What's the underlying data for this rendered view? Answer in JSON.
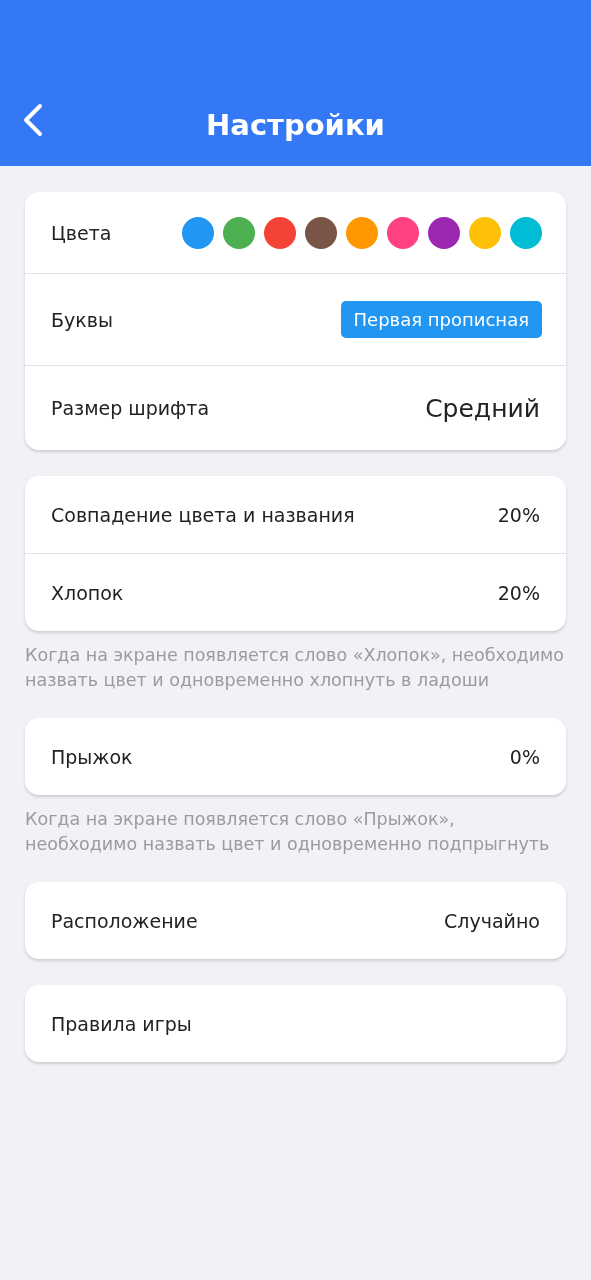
{
  "header": {
    "title": "Настройки"
  },
  "sections": [
    {
      "rows": [
        {
          "kind": "colors",
          "label": "Цвета",
          "colors": [
            {
              "color": "#2196f3"
            },
            {
              "color": "#4caf50"
            },
            {
              "color": "#f44336"
            },
            {
              "color": "#795548"
            },
            {
              "color": "#ff9800"
            },
            {
              "color": "#ff4081"
            },
            {
              "color": "#9c27b0"
            },
            {
              "color": "#ffc107"
            },
            {
              "color": "#00bcd4"
            }
          ]
        },
        {
          "kind": "chip",
          "label": "Буквы",
          "value": "Первая прописная"
        },
        {
          "kind": "large",
          "label": "Размер шрифта",
          "value": "Средний"
        }
      ]
    },
    {
      "rows": [
        {
          "kind": "value",
          "label": "Совпадение цвета и названия",
          "value": "20%"
        },
        {
          "kind": "value",
          "label": "Хлопок",
          "value": "20%"
        }
      ],
      "note": "Когда на экране появляется слово «Хлопок», необходимо назвать цвет и одновременно хлопнуть в ладоши"
    },
    {
      "rows": [
        {
          "kind": "value",
          "label": "Прыжок",
          "value": "0%"
        }
      ],
      "note": "Когда на экране появляется слово «Прыжок», необходимо назвать цвет и одновременно подпрыгнуть"
    },
    {
      "rows": [
        {
          "kind": "value",
          "label": "Расположение",
          "value": "Случайно"
        }
      ]
    },
    {
      "rows": [
        {
          "kind": "plain",
          "label": "Правила игры"
        }
      ]
    }
  ]
}
